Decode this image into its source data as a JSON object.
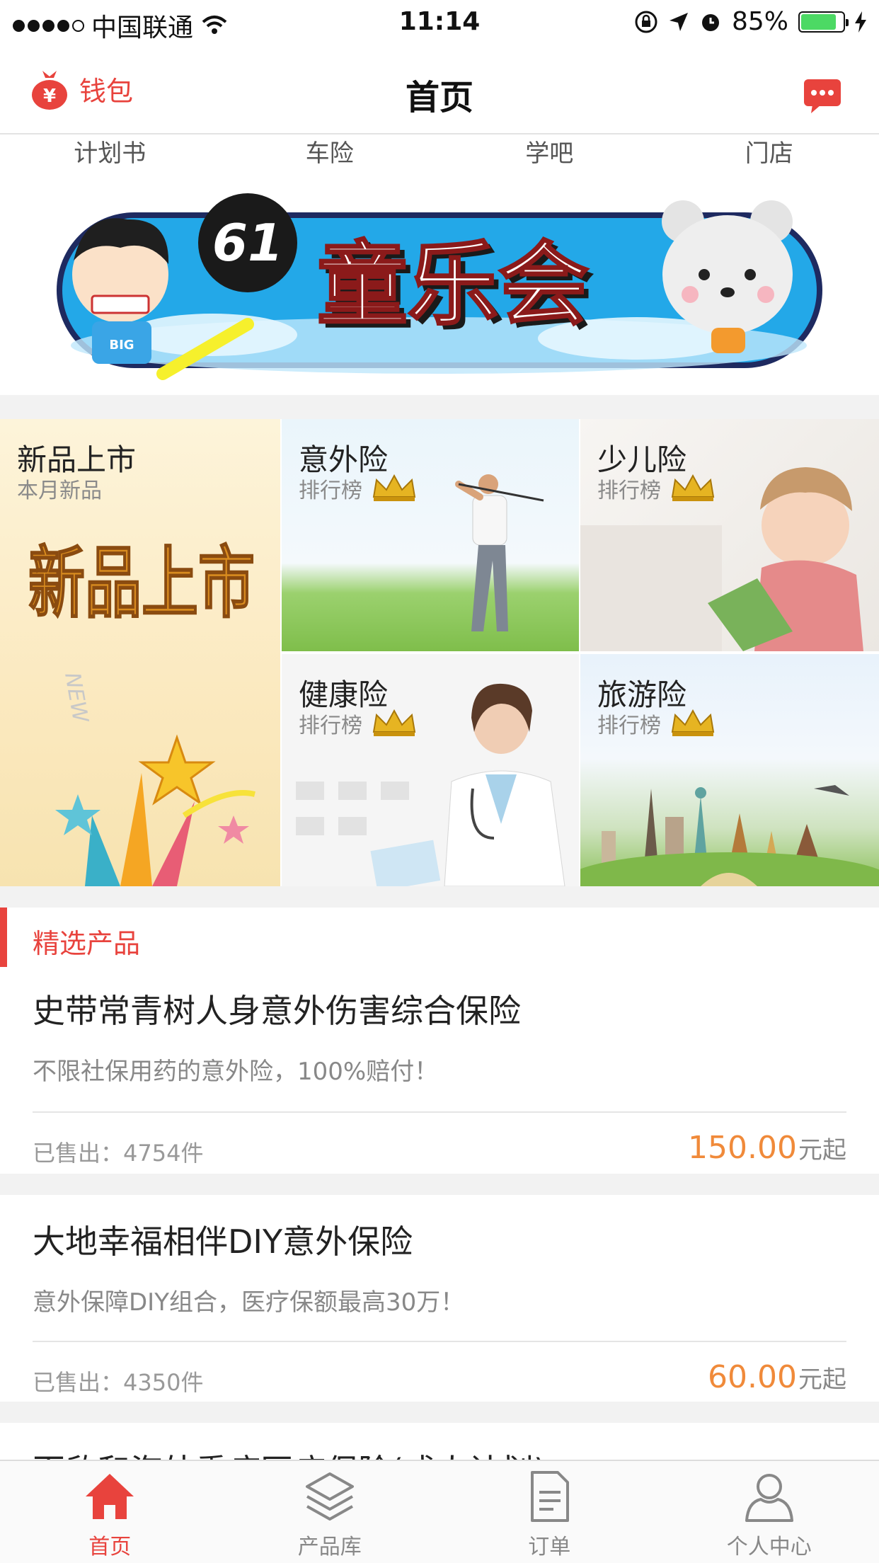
{
  "status_bar": {
    "carrier": "中国联通",
    "time": "11:14",
    "battery": "85%"
  },
  "header": {
    "wallet_label": "钱包",
    "title": "首页"
  },
  "tabs": [
    {
      "label": "计划书"
    },
    {
      "label": "车险"
    },
    {
      "label": "学吧"
    },
    {
      "label": "门店"
    }
  ],
  "banner": {
    "title": "童乐会",
    "badge": "61",
    "shirt_text": "BIG"
  },
  "grid": {
    "new": {
      "title": "新品上市",
      "subtitle": "本月新品",
      "art_text": "新品上市",
      "art_new": "NEW"
    },
    "accident": {
      "title": "意外险",
      "subtitle": "排行榜"
    },
    "kids": {
      "title": "少儿险",
      "subtitle": "排行榜"
    },
    "health": {
      "title": "健康险",
      "subtitle": "排行榜"
    },
    "travel": {
      "title": "旅游险",
      "subtitle": "排行榜"
    }
  },
  "featured": {
    "section_title": "精选产品",
    "products": [
      {
        "name": "史带常青树人身意外伤害综合保险",
        "desc": "不限社保用药的意外险，100%赔付！",
        "sold": "已售出：4754件",
        "price": "150.00",
        "unit": "元起"
      },
      {
        "name": "大地幸福相伴DIY意外保险",
        "desc": "意外保障DIY组合，医疗保额最高30万！",
        "sold": "已售出：4350件",
        "price": "60.00",
        "unit": "元起"
      },
      {
        "name": "百欣和海外重疾医疗保险(成人计划)"
      }
    ]
  },
  "tabbar": [
    {
      "label": "首页",
      "icon": "home-icon",
      "active": true
    },
    {
      "label": "产品库",
      "icon": "layers-icon",
      "active": false
    },
    {
      "label": "订单",
      "icon": "document-icon",
      "active": false
    },
    {
      "label": "个人中心",
      "icon": "person-icon",
      "active": false
    }
  ],
  "colors": {
    "accent": "#e8433d",
    "price": "#f08a3a",
    "battery": "#4cd964"
  }
}
